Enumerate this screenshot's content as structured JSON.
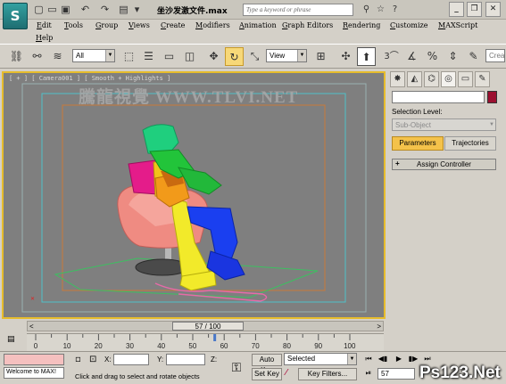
{
  "titlebar": {
    "app_icon": "3ds-max-logo-icon",
    "document_title": "坐沙发激文件.max",
    "search_placeholder": "Type a keyword or phrase",
    "window_controls": [
      "minimize",
      "restore",
      "close"
    ]
  },
  "menu": {
    "items": [
      "Edit",
      "Tools",
      "Group",
      "Views",
      "Create",
      "Modifiers",
      "Animation",
      "Graph Editors",
      "Rendering",
      "Customize",
      "MAXScript",
      "Help"
    ]
  },
  "toolbar": {
    "selection_filter": "All",
    "reference_coord": "View",
    "active_tool": "select-and-rotate",
    "snap_label": "3",
    "named_selection_placeholder": "Crea"
  },
  "viewport": {
    "label": "[ + ] [ Camera001 ] [ Smooth + Highlights ]",
    "watermark": "騰龍視覺 WWW.TLVI.NET",
    "active_border_color": "#e6bc2c",
    "background_color": "#7f7f7f"
  },
  "command_panel": {
    "active_tab": "motion",
    "tabs": [
      "create-icon",
      "modify-icon",
      "hierarchy-icon",
      "motion-icon",
      "display-icon",
      "utilities-icon"
    ],
    "object_color": "#9b1030",
    "selection_level_label": "Selection Level:",
    "sub_object_value": "Sub-Object",
    "tab_parameters": "Parameters",
    "tab_trajectories": "Trajectories",
    "rollout_title": "Assign Controller",
    "rollout_sign": "+"
  },
  "timeline": {
    "frame_display": "57 / 100",
    "current_frame": 57,
    "ticks": [
      "0",
      "10",
      "20",
      "30",
      "40",
      "50",
      "60",
      "70",
      "80",
      "90",
      "100"
    ]
  },
  "status": {
    "listener": "Welcome to MAX!",
    "prompt": "Click and drag to select and rotate objects",
    "x_label": "X:",
    "y_label": "Y:",
    "z_label": "Z:",
    "auto_key": "Auto Key",
    "set_key": "Set Key",
    "key_mode": "Selected",
    "key_filters": "Key Filters...",
    "frame_value": "57"
  },
  "overlay_watermark": "Ps123.Net"
}
